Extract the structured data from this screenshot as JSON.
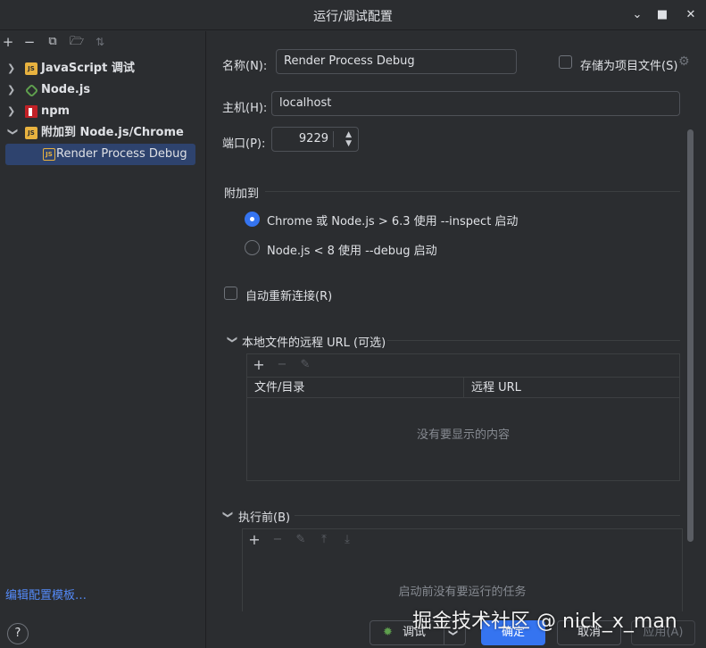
{
  "window": {
    "title": "运行/调试配置"
  },
  "sidebar": {
    "toolbar": [
      "add-icon",
      "remove-icon",
      "copy-icon",
      "new-folder-icon",
      "sort-icon"
    ],
    "items": [
      {
        "label": "JavaScript 调试",
        "icon": "javascript-icon",
        "expanded": false
      },
      {
        "label": "Node.js",
        "icon": "nodejs-icon",
        "expanded": false
      },
      {
        "label": "npm",
        "icon": "npm-icon",
        "expanded": false
      },
      {
        "label": "附加到 Node.js/Chrome",
        "icon": "javascript-icon",
        "expanded": true
      },
      {
        "label": "Render Process Debug",
        "icon": "javascript-icon",
        "selected": true
      }
    ],
    "edit_templates": "编辑配置模板…",
    "help": "?"
  },
  "form": {
    "name_label": "名称(N):",
    "name_value": "Render Process Debug",
    "store_as_file_label": "存储为项目文件(S)",
    "host_label": "主机(H):",
    "host_value": "localhost",
    "port_label": "端口(P):",
    "port_value": "9229",
    "attach_section": "附加到",
    "attach_options": [
      "Chrome 或 Node.js > 6.3 使用 --inspect 启动",
      "Node.js < 8 使用 --debug 启动"
    ],
    "reconnect_label": "自动重新连接(R)"
  },
  "remote_urls": {
    "title": "本地文件的远程 URL (可选)",
    "columns": [
      "文件/目录",
      "远程 URL"
    ],
    "empty_text": "没有要显示的内容"
  },
  "before_launch": {
    "title": "执行前(B)",
    "empty_text": "启动前没有要运行的任务"
  },
  "buttons": {
    "debug": "调试",
    "ok": "确定",
    "cancel": "取消",
    "apply": "应用(A)"
  },
  "watermark": "掘金技术社区 @ nick_x_man",
  "colors": {
    "accent": "#3574f0",
    "background": "#2b2d30",
    "selection": "#2e436e",
    "link": "#548af7"
  }
}
